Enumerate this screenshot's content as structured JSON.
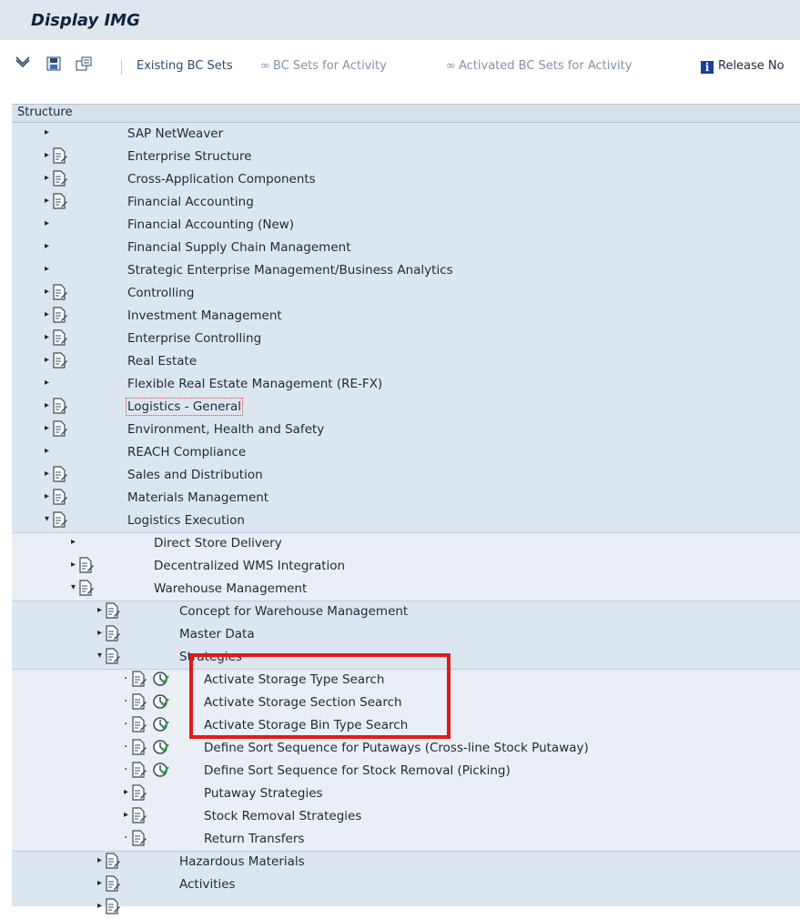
{
  "window": {
    "title": "Display IMG"
  },
  "toolbar": {
    "buttons": [
      {
        "name": "existing-bc-sets-button",
        "label": "Existing BC Sets",
        "icon": "none",
        "enabled": true
      },
      {
        "name": "bc-sets-for-activity-button",
        "label": "BC Sets for Activity",
        "icon": "link-icon",
        "enabled": false
      },
      {
        "name": "activated-bc-sets-button",
        "label": "Activated BC Sets for Activity",
        "icon": "link-icon",
        "enabled": false
      },
      {
        "name": "release-notes-button",
        "label": "Release No",
        "icon": "info-icon",
        "enabled": true
      }
    ],
    "left_icons": [
      "expand-all-icon",
      "save-icon",
      "settings-icon"
    ]
  },
  "structure": {
    "header": "Structure",
    "nodes": [
      {
        "label": "SAP NetWeaver",
        "level": 0,
        "toggle": "collapsed",
        "doc": false,
        "exec": false
      },
      {
        "label": "Enterprise Structure",
        "level": 0,
        "toggle": "collapsed",
        "doc": true,
        "exec": false
      },
      {
        "label": "Cross-Application Components",
        "level": 0,
        "toggle": "collapsed",
        "doc": true,
        "exec": false
      },
      {
        "label": "Financial Accounting",
        "level": 0,
        "toggle": "collapsed",
        "doc": true,
        "exec": false
      },
      {
        "label": "Financial Accounting (New)",
        "level": 0,
        "toggle": "collapsed",
        "doc": false,
        "exec": false
      },
      {
        "label": "Financial Supply Chain Management",
        "level": 0,
        "toggle": "collapsed",
        "doc": false,
        "exec": false
      },
      {
        "label": "Strategic Enterprise Management/Business Analytics",
        "level": 0,
        "toggle": "collapsed",
        "doc": false,
        "exec": false
      },
      {
        "label": "Controlling",
        "level": 0,
        "toggle": "collapsed",
        "doc": true,
        "exec": false
      },
      {
        "label": "Investment Management",
        "level": 0,
        "toggle": "collapsed",
        "doc": true,
        "exec": false
      },
      {
        "label": "Enterprise Controlling",
        "level": 0,
        "toggle": "collapsed",
        "doc": true,
        "exec": false
      },
      {
        "label": "Real Estate",
        "level": 0,
        "toggle": "collapsed",
        "doc": true,
        "exec": false
      },
      {
        "label": "Flexible Real Estate Management (RE-FX)",
        "level": 0,
        "toggle": "collapsed",
        "doc": false,
        "exec": false
      },
      {
        "label": "Logistics - General",
        "level": 0,
        "toggle": "collapsed",
        "doc": true,
        "exec": false,
        "focused": true
      },
      {
        "label": "Environment, Health and Safety",
        "level": 0,
        "toggle": "collapsed",
        "doc": true,
        "exec": false
      },
      {
        "label": "REACH Compliance",
        "level": 0,
        "toggle": "collapsed",
        "doc": false,
        "exec": false
      },
      {
        "label": "Sales and Distribution",
        "level": 0,
        "toggle": "collapsed",
        "doc": true,
        "exec": false
      },
      {
        "label": "Materials Management",
        "level": 0,
        "toggle": "collapsed",
        "doc": true,
        "exec": false
      },
      {
        "label": "Logistics Execution",
        "level": 0,
        "toggle": "expanded",
        "doc": true,
        "exec": false
      },
      {
        "label": "Direct Store Delivery",
        "level": 1,
        "toggle": "collapsed",
        "doc": false,
        "exec": false
      },
      {
        "label": "Decentralized WMS Integration",
        "level": 1,
        "toggle": "collapsed",
        "doc": true,
        "exec": false
      },
      {
        "label": "Warehouse Management",
        "level": 1,
        "toggle": "expanded",
        "doc": true,
        "exec": false
      },
      {
        "label": "Concept for Warehouse Management",
        "level": 2,
        "toggle": "collapsed",
        "doc": true,
        "exec": false
      },
      {
        "label": "Master Data",
        "level": 2,
        "toggle": "collapsed",
        "doc": true,
        "exec": false
      },
      {
        "label": "Strategies",
        "level": 2,
        "toggle": "expanded",
        "doc": true,
        "exec": false
      },
      {
        "label": "Activate Storage Type Search",
        "level": 3,
        "toggle": "leaf",
        "doc": true,
        "exec": true
      },
      {
        "label": "Activate Storage Section Search",
        "level": 3,
        "toggle": "leaf",
        "doc": true,
        "exec": true
      },
      {
        "label": "Activate Storage Bin Type Search",
        "level": 3,
        "toggle": "leaf",
        "doc": true,
        "exec": true
      },
      {
        "label": "Define Sort Sequence for Putaways (Cross-line Stock Putaway)",
        "level": 3,
        "toggle": "leaf",
        "doc": true,
        "exec": true
      },
      {
        "label": "Define Sort Sequence for Stock Removal (Picking)",
        "level": 3,
        "toggle": "leaf",
        "doc": true,
        "exec": true
      },
      {
        "label": "Putaway Strategies",
        "level": 3,
        "toggle": "collapsed",
        "doc": true,
        "exec": false
      },
      {
        "label": "Stock Removal Strategies",
        "level": 3,
        "toggle": "collapsed",
        "doc": true,
        "exec": false
      },
      {
        "label": "Return Transfers",
        "level": 3,
        "toggle": "leaf",
        "doc": true,
        "exec": false
      },
      {
        "label": "Hazardous Materials",
        "level": 2,
        "toggle": "collapsed",
        "doc": true,
        "exec": false
      },
      {
        "label": "Activities",
        "level": 2,
        "toggle": "collapsed",
        "doc": true,
        "exec": false
      },
      {
        "label": "",
        "level": 2,
        "toggle": "collapsed",
        "doc": true,
        "exec": false
      }
    ]
  },
  "colors": {
    "titlebar": "#dfe6ee",
    "tree_bg": "#dce6f0",
    "tree_bg_nested": "#e9eff5",
    "highlight_box": "#e31a1a"
  }
}
